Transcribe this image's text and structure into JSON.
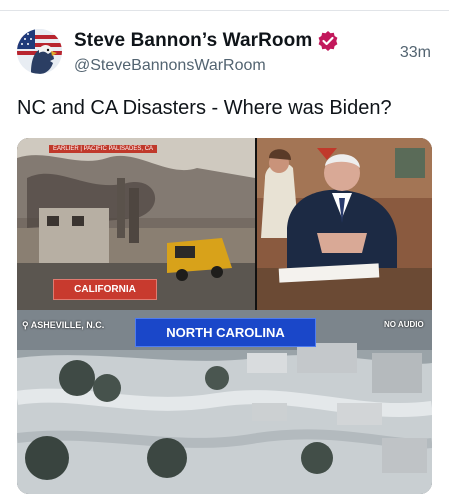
{
  "post": {
    "author_name": "Steve Bannon’s WarRoom",
    "handle": "@SteveBannonsWarRoom",
    "timestamp": "33m",
    "text": "NC and CA Disasters - Where was Biden?"
  },
  "media": {
    "ca_banner": "EARLIER | PACIFIC PALISADES, CA",
    "california_label": "CALIFORNIA",
    "asheville_label": "ASHEVILLE, N.C.",
    "nc_label": "NORTH CAROLINA",
    "audio_label": "NO AUDIO"
  },
  "colors": {
    "verified": "#c2185b",
    "california_tag": "#c83a2e",
    "nc_tag": "#1a47c9"
  },
  "icons": {
    "verified": "verified-badge-icon",
    "pin": "location-pin-icon"
  }
}
